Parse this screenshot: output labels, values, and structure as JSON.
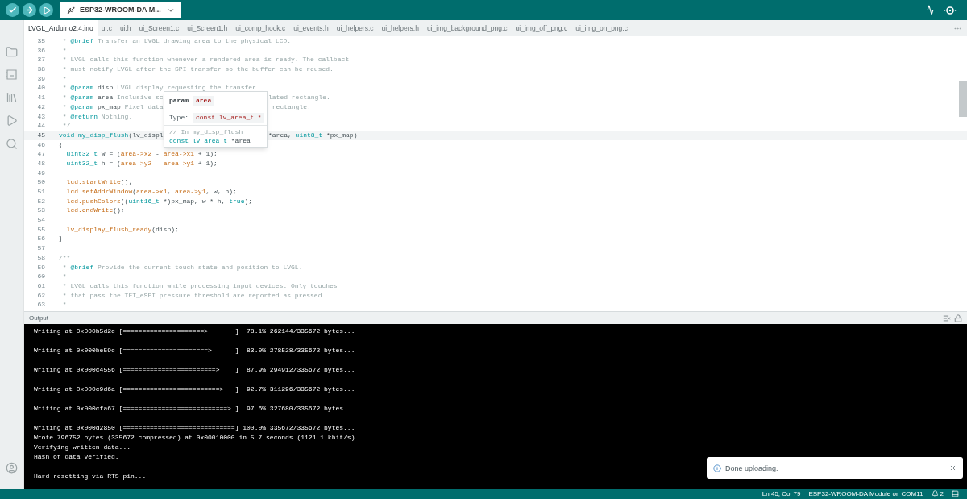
{
  "toolbar": {
    "board": "ESP32-WROOM-DA M..."
  },
  "tabs": [
    {
      "label": "LVGL_Arduino2.4.ino",
      "selected": true
    },
    {
      "label": "ui.c",
      "selected": false
    },
    {
      "label": "ui.h",
      "selected": false
    },
    {
      "label": "ui_Screen1.c",
      "selected": false
    },
    {
      "label": "ui_Screen1.h",
      "selected": false
    },
    {
      "label": "ui_comp_hook.c",
      "selected": false
    },
    {
      "label": "ui_events.h",
      "selected": false
    },
    {
      "label": "ui_helpers.c",
      "selected": false
    },
    {
      "label": "ui_helpers.h",
      "selected": false
    },
    {
      "label": "ui_img_background_png.c",
      "selected": false
    },
    {
      "label": "ui_img_off_png.c",
      "selected": false
    },
    {
      "label": "ui_img_on_png.c",
      "selected": false
    }
  ],
  "editor": {
    "lines": [
      {
        "number": "35",
        "current": false,
        "tokens": [
          {
            "kind": "comment",
            "text": " * "
          },
          {
            "kind": "tag",
            "text": "@brief"
          },
          {
            "kind": "comment",
            "text": " Transfer an LVGL drawing area to the physical LCD."
          }
        ]
      },
      {
        "number": "36",
        "current": false,
        "tokens": [
          {
            "kind": "comment",
            "text": " *"
          }
        ]
      },
      {
        "number": "37",
        "current": false,
        "tokens": [
          {
            "kind": "comment",
            "text": " * LVGL calls this function whenever a rendered area is ready. The callback"
          }
        ]
      },
      {
        "number": "38",
        "current": false,
        "tokens": [
          {
            "kind": "comment",
            "text": " * must notify LVGL after the SPI transfer so the buffer can be reused."
          }
        ]
      },
      {
        "number": "39",
        "current": false,
        "tokens": [
          {
            "kind": "comment",
            "text": " *"
          }
        ]
      },
      {
        "number": "40",
        "current": false,
        "tokens": [
          {
            "kind": "comment",
            "text": " * "
          },
          {
            "kind": "tag",
            "text": "@param"
          },
          {
            "kind": "plain",
            "text": " disp"
          },
          {
            "kind": "comment",
            "text": " LVGL display requesting the transfer."
          }
        ]
      },
      {
        "number": "41",
        "current": false,
        "tokens": [
          {
            "kind": "comment",
            "text": " * "
          },
          {
            "kind": "tag",
            "text": "@param"
          },
          {
            "kind": "plain",
            "text": " area"
          },
          {
            "kind": "comment",
            "text": " Inclusive sc"
          }
        ],
        "after_popup": [
          {
            "kind": "comment",
            "text": "lated rectangle."
          }
        ]
      },
      {
        "number": "42",
        "current": false,
        "tokens": [
          {
            "kind": "comment",
            "text": " * "
          },
          {
            "kind": "tag",
            "text": "@param"
          },
          {
            "kind": "plain",
            "text": " px_map"
          },
          {
            "kind": "comment",
            "text": " Pixel data"
          }
        ],
        "after_popup": [
          {
            "kind": "comment",
            "text": " rectangle."
          }
        ]
      },
      {
        "number": "43",
        "current": false,
        "tokens": [
          {
            "kind": "comment",
            "text": " * "
          },
          {
            "kind": "tag",
            "text": "@return"
          },
          {
            "kind": "comment",
            "text": " Nothing."
          }
        ]
      },
      {
        "number": "44",
        "current": false,
        "tokens": [
          {
            "kind": "comment",
            "text": " */"
          }
        ]
      },
      {
        "number": "45",
        "current": true,
        "tokens": [
          {
            "kind": "type",
            "text": "void my_disp_flush"
          },
          {
            "kind": "plain",
            "text": "(lv_displ"
          }
        ],
        "after_popup": [
          {
            "kind": "plain",
            "text": "*area, "
          },
          {
            "kind": "type",
            "text": "uint8_t"
          },
          {
            "kind": "plain",
            "text": " *px_map)"
          }
        ]
      },
      {
        "number": "46",
        "current": false,
        "tokens": [
          {
            "kind": "plain",
            "text": "{"
          }
        ]
      },
      {
        "number": "47",
        "current": false,
        "tokens": [
          {
            "kind": "type",
            "text": "  uint32_t"
          },
          {
            "kind": "plain",
            "text": " w = ("
          },
          {
            "kind": "func",
            "text": "area->x2"
          },
          {
            "kind": "plain",
            "text": " - "
          },
          {
            "kind": "func",
            "text": "area->x1"
          },
          {
            "kind": "plain",
            "text": " + 1);"
          }
        ]
      },
      {
        "number": "48",
        "current": false,
        "tokens": [
          {
            "kind": "type",
            "text": "  uint32_t"
          },
          {
            "kind": "plain",
            "text": " h = ("
          },
          {
            "kind": "func",
            "text": "area->y2"
          },
          {
            "kind": "plain",
            "text": " - "
          },
          {
            "kind": "func",
            "text": "area->y1"
          },
          {
            "kind": "plain",
            "text": " + 1);"
          }
        ]
      },
      {
        "number": "49",
        "current": false
      },
      {
        "number": "50",
        "current": false,
        "tokens": [
          {
            "kind": "func",
            "text": "  lcd.startWrite"
          },
          {
            "kind": "plain",
            "text": "();"
          }
        ]
      },
      {
        "number": "51",
        "current": false,
        "tokens": [
          {
            "kind": "func",
            "text": "  lcd.setAddrWindow"
          },
          {
            "kind": "plain",
            "text": "("
          },
          {
            "kind": "func",
            "text": "area->x1"
          },
          {
            "kind": "plain",
            "text": ", "
          },
          {
            "kind": "func",
            "text": "area->y1"
          },
          {
            "kind": "plain",
            "text": ", w, h);"
          }
        ]
      },
      {
        "number": "52",
        "current": false,
        "tokens": [
          {
            "kind": "func",
            "text": "  lcd.pushColors"
          },
          {
            "kind": "plain",
            "text": "(("
          },
          {
            "kind": "type",
            "text": "uint16_t"
          },
          {
            "kind": "plain",
            "text": " *)px_map, w * h, "
          },
          {
            "kind": "type",
            "text": "true"
          },
          {
            "kind": "plain",
            "text": ");"
          }
        ]
      },
      {
        "number": "53",
        "current": false,
        "tokens": [
          {
            "kind": "func",
            "text": "  lcd.endWrite"
          },
          {
            "kind": "plain",
            "text": "();"
          }
        ]
      },
      {
        "number": "54",
        "current": false
      },
      {
        "number": "55",
        "current": false,
        "tokens": [
          {
            "kind": "func",
            "text": "  lv_display_flush_ready"
          },
          {
            "kind": "plain",
            "text": "(disp);"
          }
        ]
      },
      {
        "number": "56",
        "current": false,
        "tokens": [
          {
            "kind": "plain",
            "text": "}"
          }
        ]
      },
      {
        "number": "57",
        "current": false
      },
      {
        "number": "58",
        "current": false,
        "tokens": [
          {
            "kind": "comment",
            "text": "/**"
          }
        ]
      },
      {
        "number": "59",
        "current": false,
        "tokens": [
          {
            "kind": "comment",
            "text": " * "
          },
          {
            "kind": "tag",
            "text": "@brief"
          },
          {
            "kind": "comment",
            "text": " Provide the current touch state and position to LVGL."
          }
        ]
      },
      {
        "number": "60",
        "current": false,
        "tokens": [
          {
            "kind": "comment",
            "text": " *"
          }
        ]
      },
      {
        "number": "61",
        "current": false,
        "tokens": [
          {
            "kind": "comment",
            "text": " * LVGL calls this function while processing input devices. Only touches"
          }
        ]
      },
      {
        "number": "62",
        "current": false,
        "tokens": [
          {
            "kind": "comment",
            "text": " * that pass the TFT_eSPI pressure threshold are reported as pressed."
          }
        ]
      },
      {
        "number": "63",
        "current": false,
        "tokens": [
          {
            "kind": "comment",
            "text": " *"
          }
        ]
      }
    ],
    "hover_popup": {
      "label": "param",
      "name": "area",
      "type_label": "Type:",
      "type": "const lv_area_t *",
      "comment": "// In my_disp_flush",
      "signature_type": "const lv_area_t",
      "signature_rest": " *area"
    }
  },
  "output": {
    "title": "Output",
    "blocks": [
      [
        "Writing at 0x000b5d2c [=====================>       ]  78.1% 262144/335672 bytes..."
      ],
      [
        "Writing at 0x000be59c [======================>      ]  83.0% 278528/335672 bytes..."
      ],
      [
        "Writing at 0x000c4556 [========================>    ]  87.9% 294912/335672 bytes..."
      ],
      [
        "Writing at 0x000c9d6a [=========================>   ]  92.7% 311296/335672 bytes..."
      ],
      [
        "Writing at 0x000cfa67 [===========================> ]  97.6% 327680/335672 bytes..."
      ],
      [
        "Writing at 0x000d2850 [=============================] 100.0% 335672/335672 bytes...",
        "Wrote 796752 bytes (335672 compressed) at 0x00010000 in 5.7 seconds (1121.1 kbit/s).",
        "Verifying written data...",
        "Hash of data verified."
      ],
      [
        "Hard resetting via RTS pin..."
      ]
    ]
  },
  "toast": {
    "message": "Done uploading."
  },
  "status_bar": {
    "position": "Ln 45, Col 79",
    "board": "ESP32-WROOM-DA Module on COM11",
    "notifications": "2"
  }
}
